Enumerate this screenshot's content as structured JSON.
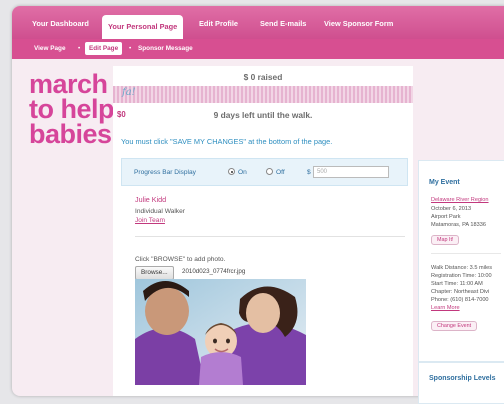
{
  "nav": {
    "tabs": [
      "Your Dashboard",
      "Your Personal Page",
      "Edit Profile",
      "Send E-mails",
      "View Sponsor Form"
    ]
  },
  "subnav": {
    "items": [
      "View Page",
      "Edit Page",
      "Sponsor Message"
    ],
    "separator": "•"
  },
  "logo": {
    "line1": "march",
    "line2": "to help",
    "line3": "babies"
  },
  "progress": {
    "raised_text": "$ 0 raised",
    "fill_fraction": 0,
    "script_label": "fa!",
    "amount_label": "$0",
    "days_left_text": "9 days left until the walk."
  },
  "notice": "You must click \"SAVE MY CHANGES\" at the bottom of the page.",
  "progress_display": {
    "label": "Progress Bar Display",
    "on_label": "On",
    "off_label": "Off",
    "currency": "$",
    "goal_value": "500"
  },
  "walker": {
    "name": "Julie Kidd",
    "type": "Individual Walker",
    "join_link": "Join Team"
  },
  "photo_upload": {
    "hint": "Click \"BROWSE\" to add photo.",
    "browse_label": "Browse...",
    "filename": "2010d023_0774frcr.jpg"
  },
  "event": {
    "title": "My Event",
    "region_link": "Delaware River Region",
    "date": "October 6, 2013",
    "location": "Airport Park",
    "city": "Matamoras, PA 18336",
    "map_button": "Map It!",
    "walk_distance": "Walk Distance: 3.5 miles",
    "registration_time": "Registration Time: 10:00",
    "start_time": "Start Time: 11:00 AM",
    "chapter": "Chapter: Northeast Divi",
    "phone": "Phone: (610) 814-7000",
    "learn_more": "Learn More",
    "change_event": "Change Event"
  },
  "sponsorship": {
    "title": "Sponsorship Levels"
  },
  "colors": {
    "brand_pink": "#d6459a",
    "nav_pink": "#d74f91",
    "link_blue": "#2f8fc0"
  }
}
